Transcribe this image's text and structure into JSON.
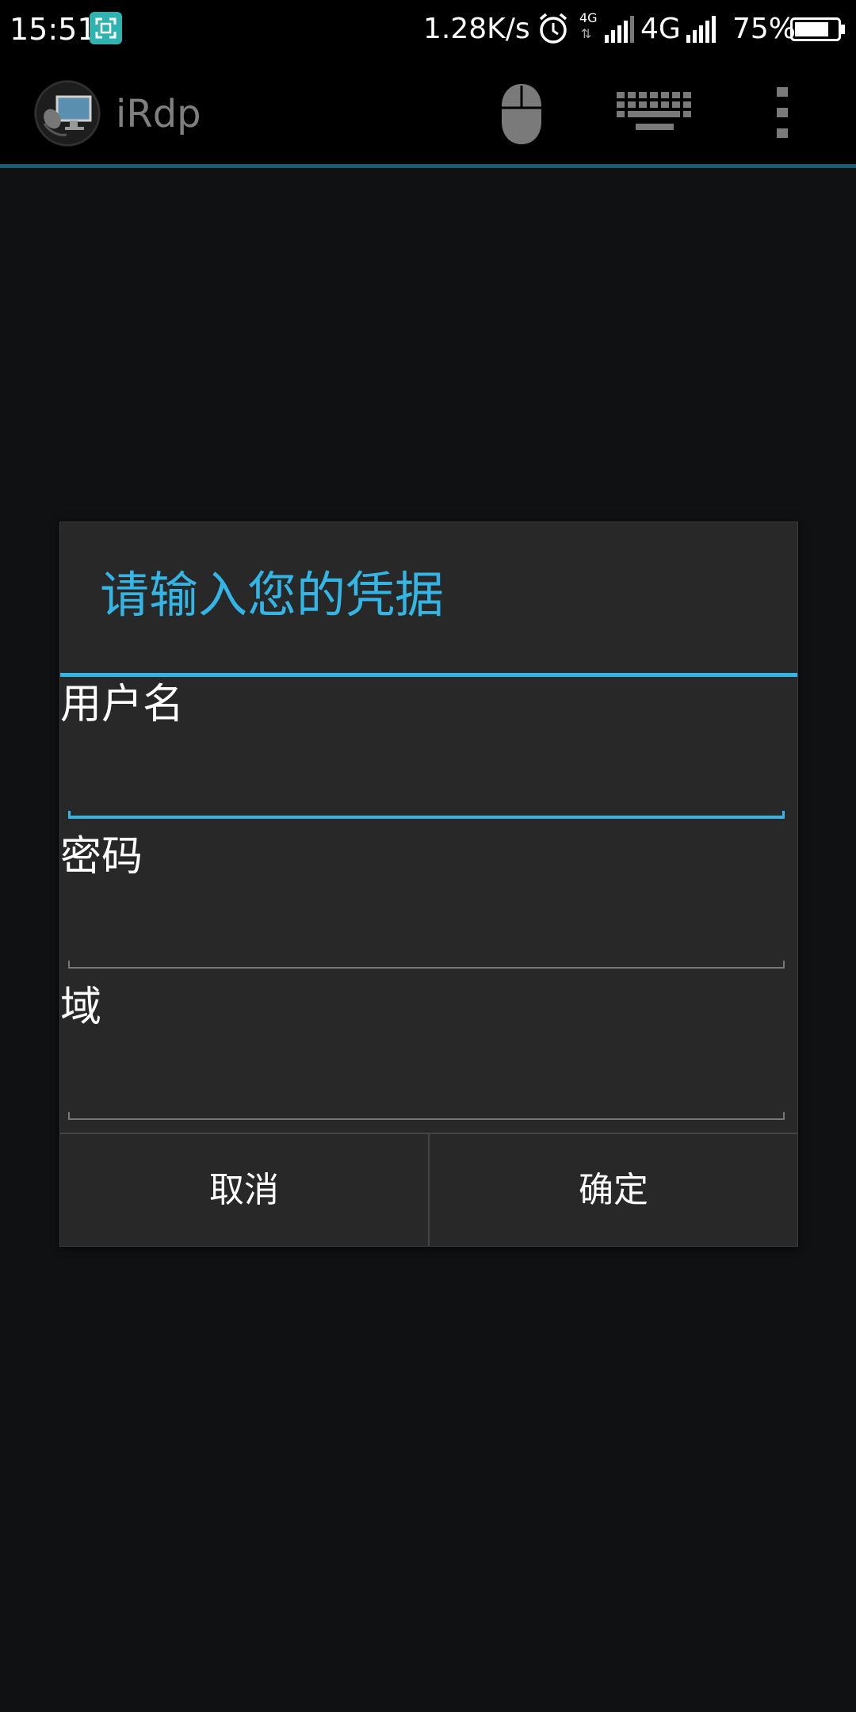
{
  "status_bar": {
    "time": "15:51",
    "speed": "1.28K/s",
    "small_network": "4G",
    "small_arrows": "⇅",
    "network_type": "4G",
    "battery": "75%",
    "icons": [
      "screenshot-icon",
      "alarm-icon",
      "signal-icon",
      "battery-icon"
    ]
  },
  "action_bar": {
    "title": "iRdp",
    "accent_color": "#1a5a73",
    "icons": [
      "app-logo-icon",
      "mouse-icon",
      "keyboard-icon",
      "overflow-menu-icon"
    ]
  },
  "dialog": {
    "title": "请输入您的凭据",
    "accent_color": "#33b5e5",
    "fields": [
      {
        "label": "用户名",
        "value": "",
        "placeholder": ""
      },
      {
        "label": "密码",
        "value": "",
        "placeholder": ""
      },
      {
        "label": "域",
        "value": "",
        "placeholder": ""
      }
    ],
    "cancel_label": "取消",
    "ok_label": "确定"
  }
}
